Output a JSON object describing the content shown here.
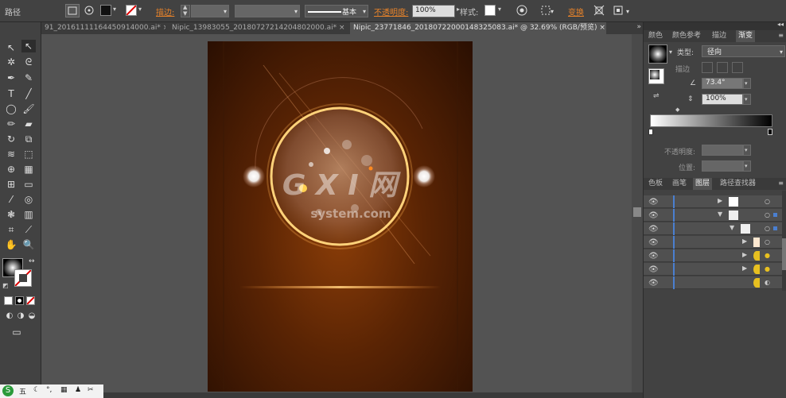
{
  "control_bar": {
    "selection_type": "路径",
    "stroke_label": "描边:",
    "stroke_profile": "基本",
    "opacity_label": "不透明度:",
    "opacity_value": "100%",
    "style_label": "样式:",
    "transform_label": "变换"
  },
  "doc_tabs": [
    {
      "label": "91_20161111164450914000.ai*",
      "close": "×"
    },
    {
      "label": "Nipic_13983055_20180727214204802000.ai*",
      "close": "×"
    },
    {
      "label": "Nipic_23771846_20180722000148325083.ai* @ 32.69% (RGB/预览)",
      "close": "×"
    }
  ],
  "gradient_panel": {
    "tabs": [
      "颜色",
      "颜色参考",
      "描边",
      "渐变"
    ],
    "type_label": "类型:",
    "type_value": "径向",
    "stroke_label": "描边",
    "angle_value": "73.4°",
    "aspect_value": "100%",
    "opacity_label": "不透明度:",
    "location_label": "位置:"
  },
  "layers_panel": {
    "tabs": [
      "色板",
      "画笔",
      "图层",
      "路径查找器"
    ]
  },
  "watermark": {
    "main": "G X I 网",
    "sub": "system.com"
  },
  "colors": {
    "ui_dark": "#424242",
    "canvas": "#535353",
    "artboard_brown": "#5a2404",
    "accent_orange": "#e8832a",
    "ring_gold": "#ffd27a"
  }
}
